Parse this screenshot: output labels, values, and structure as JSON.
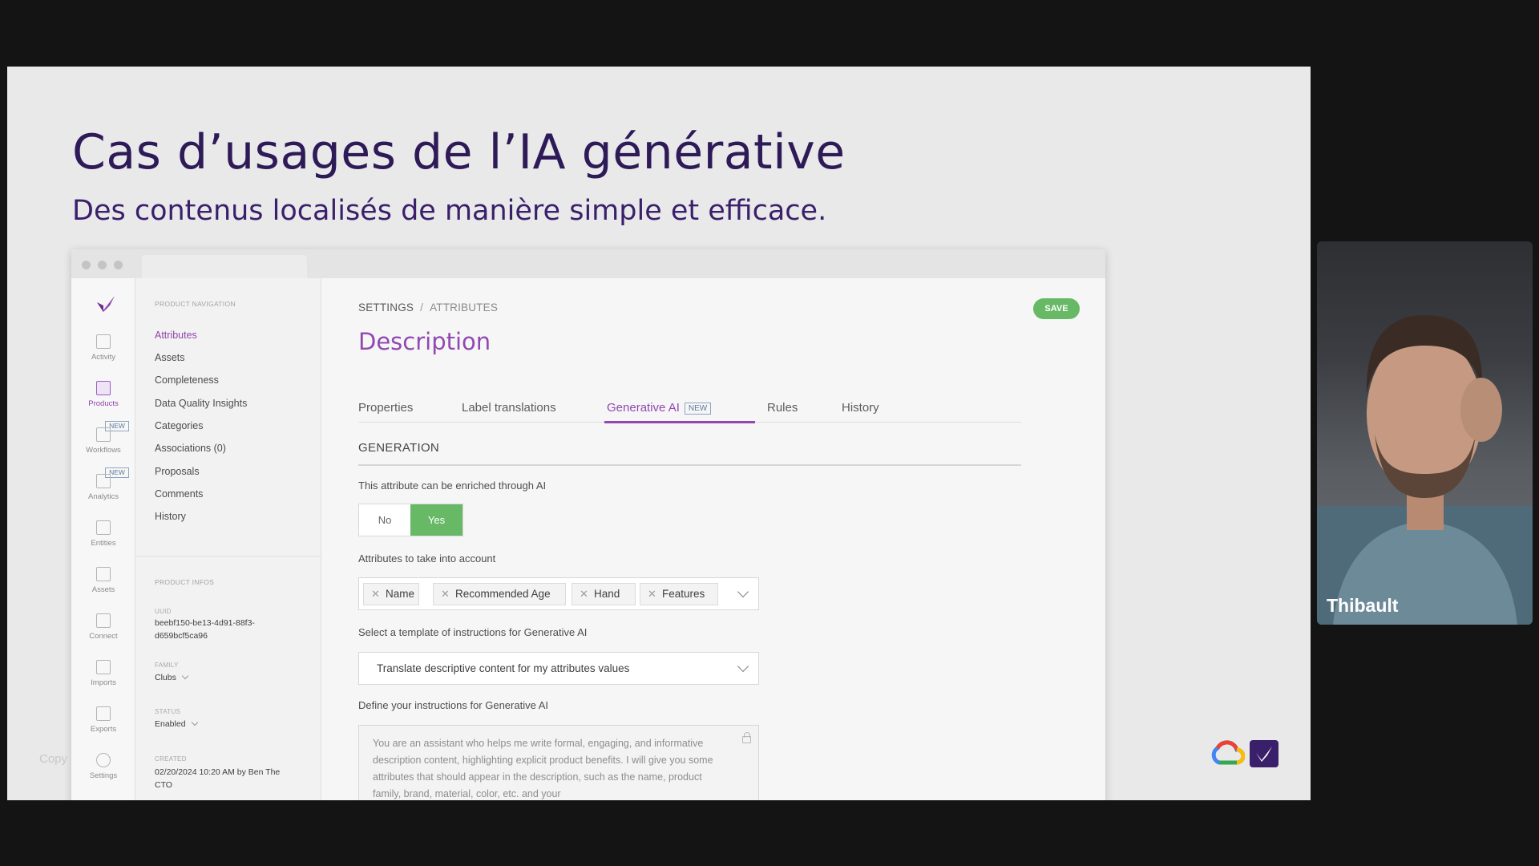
{
  "slide": {
    "title": "Cas d’usages de l’IA générative",
    "subtitle": "Des contenus localisés de manière simple et efficace.",
    "faint_text": "Copy"
  },
  "rail": {
    "items": [
      {
        "label": "Activity",
        "icon": "grid-icon"
      },
      {
        "label": "Products",
        "icon": "clipboard-icon",
        "active": true
      },
      {
        "label": "Workflows",
        "icon": "workflow-icon",
        "badge": "NEW"
      },
      {
        "label": "Analytics",
        "icon": "bar-chart-icon",
        "badge": "NEW"
      },
      {
        "label": "Entities",
        "icon": "entities-icon"
      },
      {
        "label": "Assets",
        "icon": "image-icon"
      },
      {
        "label": "Connect",
        "icon": "link-icon"
      },
      {
        "label": "Imports",
        "icon": "download-icon"
      },
      {
        "label": "Exports",
        "icon": "upload-icon"
      },
      {
        "label": "Settings",
        "icon": "gear-icon"
      }
    ]
  },
  "nav": {
    "section_title": "PRODUCT NAVIGATION",
    "links": [
      "Attributes",
      "Assets",
      "Completeness",
      "Data Quality Insights",
      "Categories",
      "Associations (0)",
      "Proposals",
      "Comments",
      "History"
    ],
    "info_title": "PRODUCT INFOS",
    "uuid_label": "UUID",
    "uuid_line1": "beebf150-be13-4d91-88f3-",
    "uuid_line2": "d659bcf5ca96",
    "family_label": "FAMILY",
    "family_value": "Clubs",
    "status_label": "STATUS",
    "status_value": "Enabled",
    "created_label": "CREATED",
    "created_line1": "02/20/2024 10:20 AM by Ben The",
    "created_line2": "CTO"
  },
  "main": {
    "breadcrumb": [
      "SETTINGS",
      "ATTRIBUTES"
    ],
    "breadcrumb_sep": "/",
    "save_label": "SAVE",
    "title": "Description",
    "tabs": [
      "Properties",
      "Label translations",
      "Generative AI",
      "Rules",
      "History"
    ],
    "tab_new_badge": "NEW",
    "active_tab": "Generative AI",
    "section": "GENERATION",
    "enrich_label": "This attribute can be enriched through AI",
    "toggle_no": "No",
    "toggle_yes": "Yes",
    "attributes_label": "Attributes to take into account",
    "chips": [
      "Name",
      "Recommended Age",
      "Hand",
      "Features"
    ],
    "chip_remove": "✕",
    "template_label": "Select a template of instructions for Generative AI",
    "template_value": "Translate descriptive content for my attributes values",
    "instructions_label": "Define your instructions for Generative AI",
    "instructions_text": "You are an assistant who helps me write formal, engaging, and informative description content, highlighting explicit product benefits. I will give you some attributes that should appear in the description, such as the name, product family, brand, material, color, etc. and your"
  },
  "presenter": {
    "name": "Thibault"
  },
  "colors": {
    "accent": "#9148b2",
    "title": "#2d1a57",
    "save_green": "#67b965"
  }
}
